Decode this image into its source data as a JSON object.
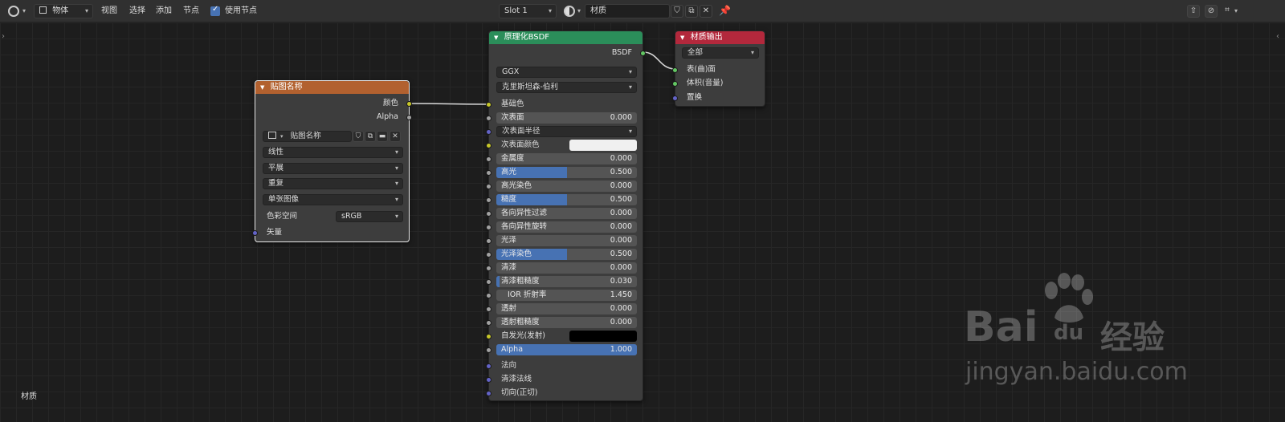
{
  "header": {
    "mode": "物体",
    "menus": [
      "视图",
      "选择",
      "添加",
      "节点"
    ],
    "use_nodes_label": "使用节点",
    "slot": "Slot 1",
    "material_name": "材质"
  },
  "canvas": {
    "corner_label": "材质"
  },
  "image_node": {
    "title": "贴图名称",
    "outputs": [
      "颜色",
      "Alpha"
    ],
    "image_name": "贴图名称",
    "interpolation": "线性",
    "projection": "平展",
    "extension": "重复",
    "source": "单张图像",
    "color_space_label": "色彩空间",
    "color_space": "sRGB",
    "vector_label": "矢量"
  },
  "bsdf_node": {
    "title": "原理化BSDF",
    "output": "BSDF",
    "distribution": "GGX",
    "subsurface_method": "克里斯坦森-伯利",
    "base_color_label": "基础色",
    "fields": [
      {
        "label": "次表面",
        "value": "0.000",
        "fill": 0.0
      },
      {
        "label": "次表面半径",
        "value": "",
        "fill": 0.0,
        "dropdown": true
      },
      {
        "label": "次表面颜色",
        "value": "",
        "fill": 0.0,
        "color": "#f0f0f0"
      },
      {
        "label": "金属度",
        "value": "0.000",
        "fill": 0.0
      },
      {
        "label": "高光",
        "value": "0.500",
        "fill": 0.5
      },
      {
        "label": "高光染色",
        "value": "0.000",
        "fill": 0.0
      },
      {
        "label": "糙度",
        "value": "0.500",
        "fill": 0.5
      },
      {
        "label": "各向异性过滤",
        "value": "0.000",
        "fill": 0.0
      },
      {
        "label": "各向异性旋转",
        "value": "0.000",
        "fill": 0.0
      },
      {
        "label": "光泽",
        "value": "0.000",
        "fill": 0.0
      },
      {
        "label": "光泽染色",
        "value": "0.500",
        "fill": 0.5
      },
      {
        "label": "清漆",
        "value": "0.000",
        "fill": 0.0
      },
      {
        "label": "清漆粗糙度",
        "value": "0.030",
        "fill": 0.03
      },
      {
        "label": "IOR 折射率",
        "value": "1.450",
        "fill": 0.0
      },
      {
        "label": "透射",
        "value": "0.000",
        "fill": 0.0
      },
      {
        "label": "透射粗糙度",
        "value": "0.000",
        "fill": 0.0
      },
      {
        "label": "自发光(发射)",
        "value": "",
        "fill": 0.0,
        "color": "#000000"
      },
      {
        "label": "Alpha",
        "value": "1.000",
        "fill": 1.0
      }
    ],
    "vector_inputs": [
      "法向",
      "清漆法线",
      "切向(正切)"
    ]
  },
  "output_node": {
    "title": "材质输出",
    "target": "全部",
    "inputs": [
      "表(曲)面",
      "体积(音量)",
      "置换"
    ]
  },
  "watermark": {
    "brand": "Bai",
    "brand_du": "du",
    "cn": "经验",
    "url": "jingyan.baidu.com"
  },
  "colors": {
    "image_header": "#b2612f",
    "bsdf_header": "#2b8e5a",
    "output_header": "#b3283c",
    "accent": "#4772b3"
  }
}
